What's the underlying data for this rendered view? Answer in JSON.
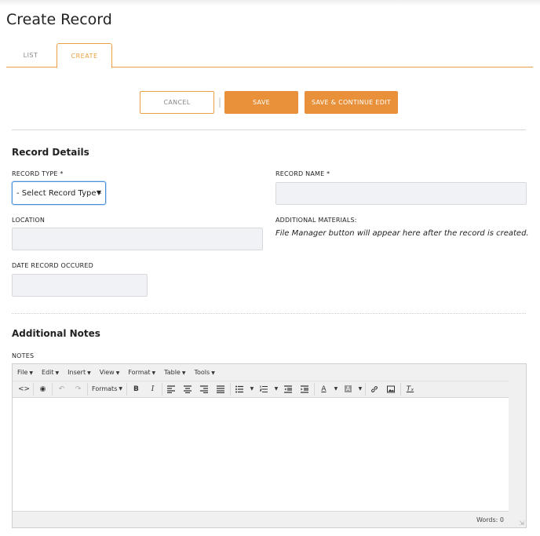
{
  "page": {
    "title": "Create Record"
  },
  "tabs": [
    {
      "label": "LIST",
      "active": false
    },
    {
      "label": "CREATE",
      "active": true
    }
  ],
  "actions": {
    "cancel_label": "CANCEL",
    "separator": "|",
    "save_label": "SAVE",
    "save_continue_label": "SAVE & CONTINUE EDIT"
  },
  "record_details": {
    "title": "Record Details",
    "record_type": {
      "label": "RECORD TYPE *",
      "selected": "- Select Record Type -"
    },
    "record_name": {
      "label": "RECORD NAME *",
      "value": ""
    },
    "location": {
      "label": "LOCATION",
      "value": ""
    },
    "additional_materials": {
      "label": "ADDITIONAL MATERIALS:",
      "note": "File Manager button will appear here after the record is created."
    },
    "date_occured": {
      "label": "DATE RECORD OCCURED",
      "value": ""
    }
  },
  "additional_notes": {
    "title": "Additional Notes",
    "notes_label": "NOTES"
  },
  "editor": {
    "menus": [
      "File",
      "Edit",
      "Insert",
      "View",
      "Format",
      "Table",
      "Tools"
    ],
    "formats_label": "Formats",
    "word_count": "Words: 0",
    "icons": [
      "code-icon",
      "preview-icon",
      "undo-icon",
      "redo-icon",
      "bold-icon",
      "italic-icon",
      "align-left-icon",
      "align-center-icon",
      "align-right-icon",
      "align-justify-icon",
      "bullet-list-icon",
      "numbered-list-icon",
      "outdent-icon",
      "indent-icon",
      "text-color-icon",
      "background-color-icon",
      "link-icon",
      "image-icon",
      "clear-format-icon"
    ]
  },
  "colors": {
    "accent": "#e9913a",
    "input_bg": "#f1f2f5",
    "focus": "#4a90d9"
  }
}
